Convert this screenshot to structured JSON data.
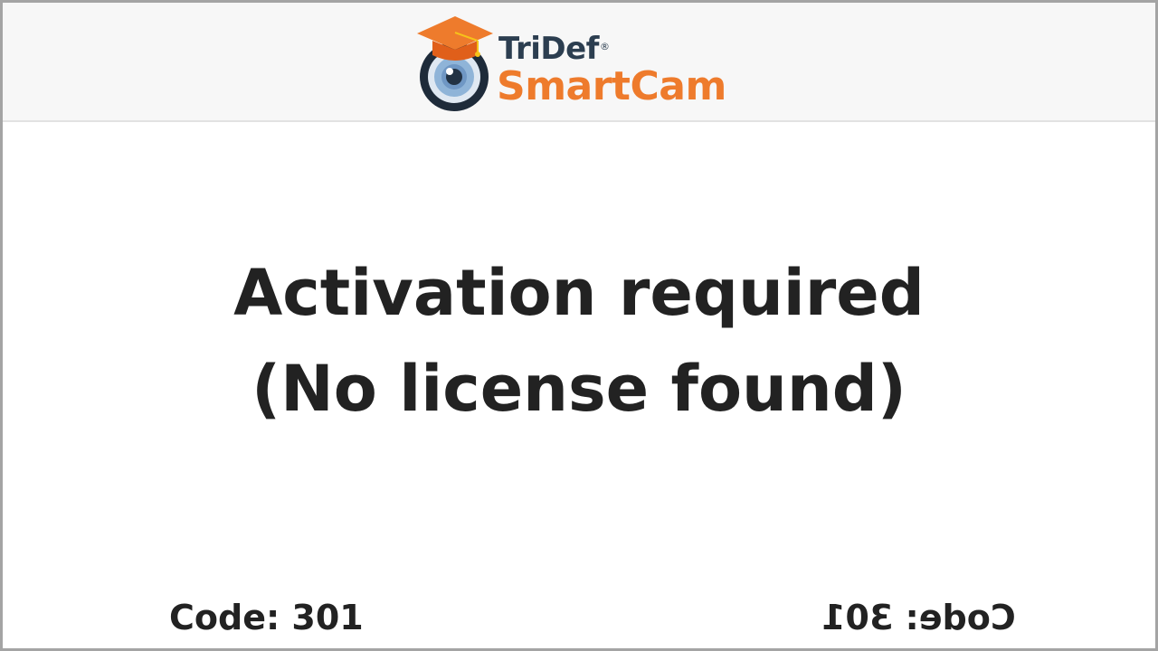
{
  "header": {
    "brand_line1": "TriDef",
    "brand_trademark": "®",
    "brand_line2": "SmartCam",
    "logo_icon": "graduation-cap-camera-lens-icon"
  },
  "message": {
    "line1": "Activation required",
    "line2": "(No license found)"
  },
  "footer": {
    "code_left": "Code: 301",
    "code_right_mirrored": "Code: 301"
  },
  "colors": {
    "brand_dark": "#2c3e50",
    "brand_orange": "#ee7b2c",
    "text": "#222222",
    "header_bg": "#f7f7f7",
    "frame_border": "#a4a4a4"
  }
}
